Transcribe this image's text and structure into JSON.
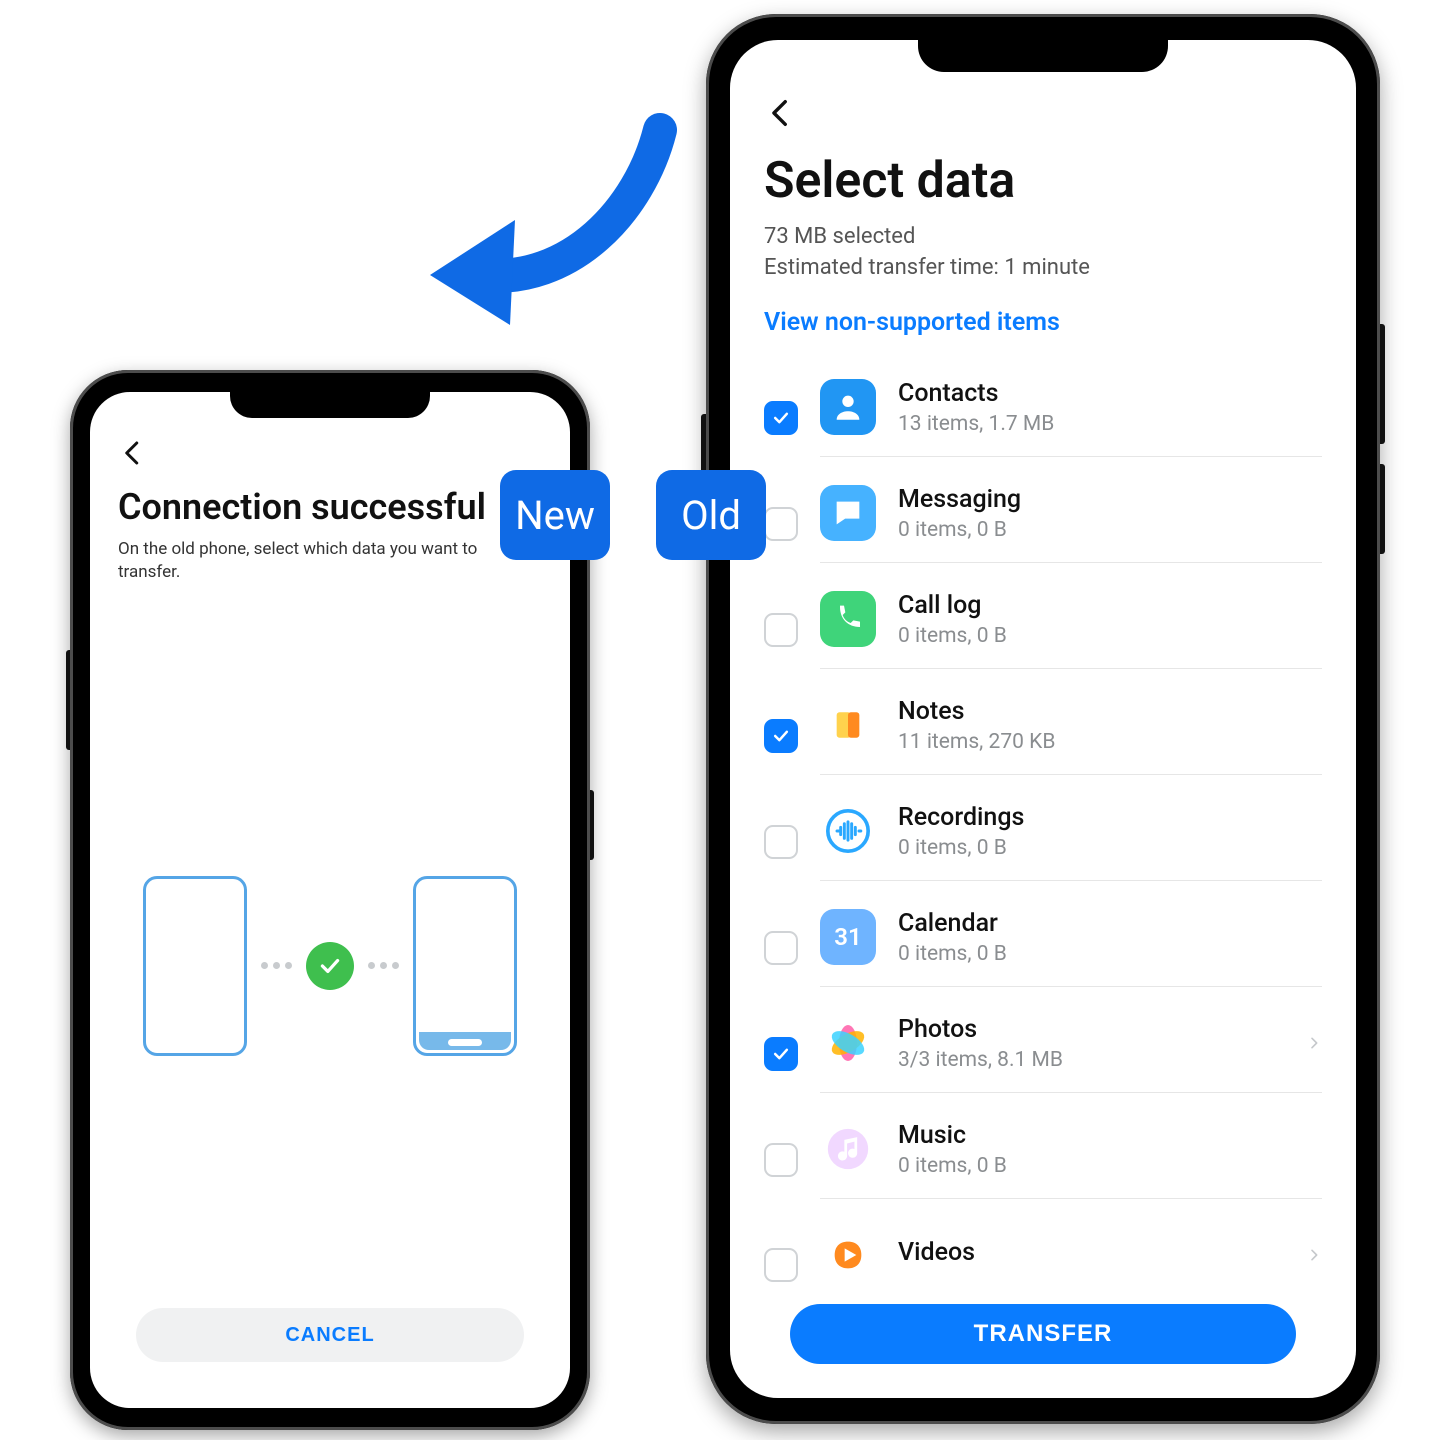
{
  "new_phone": {
    "title": "Connection successful",
    "subtitle": "On the old phone, select which data you want to transfer.",
    "cancel_label": "CANCEL"
  },
  "tags": {
    "new": "New",
    "old": "Old"
  },
  "old_phone": {
    "title": "Select data",
    "size_line": "73 MB selected",
    "time_line": "Estimated transfer time: 1 minute",
    "link": "View non-supported items",
    "transfer_label": "TRANSFER",
    "items": [
      {
        "title": "Contacts",
        "sub": "13 items, 1.7 MB",
        "checked": true,
        "icon": "contacts",
        "chevron": false
      },
      {
        "title": "Messaging",
        "sub": "0 items, 0 B",
        "checked": false,
        "icon": "messaging",
        "chevron": false
      },
      {
        "title": "Call log",
        "sub": "0 items, 0 B",
        "checked": false,
        "icon": "calllog",
        "chevron": false
      },
      {
        "title": "Notes",
        "sub": "11 items, 270 KB",
        "checked": true,
        "icon": "notes",
        "chevron": false
      },
      {
        "title": "Recordings",
        "sub": "0 items, 0 B",
        "checked": false,
        "icon": "recordings",
        "chevron": false
      },
      {
        "title": "Calendar",
        "sub": "0 items, 0 B",
        "checked": false,
        "icon": "calendar",
        "chevron": false
      },
      {
        "title": "Photos",
        "sub": "3/3 items, 8.1 MB",
        "checked": true,
        "icon": "photos",
        "chevron": true
      },
      {
        "title": "Music",
        "sub": "0 items, 0 B",
        "checked": false,
        "icon": "music",
        "chevron": false
      },
      {
        "title": "Videos",
        "sub": "",
        "checked": false,
        "icon": "videos",
        "chevron": true
      }
    ]
  },
  "icon_colors": {
    "contacts": "#2196f3",
    "messaging": "#46b2ff",
    "calllog": "#3fd47a",
    "notes": "#ff9f1a",
    "recordings": "#ffffff",
    "calendar": "#6fb4ff",
    "photos": "#ffffff",
    "music": "#ffffff",
    "videos": "#ffffff"
  }
}
